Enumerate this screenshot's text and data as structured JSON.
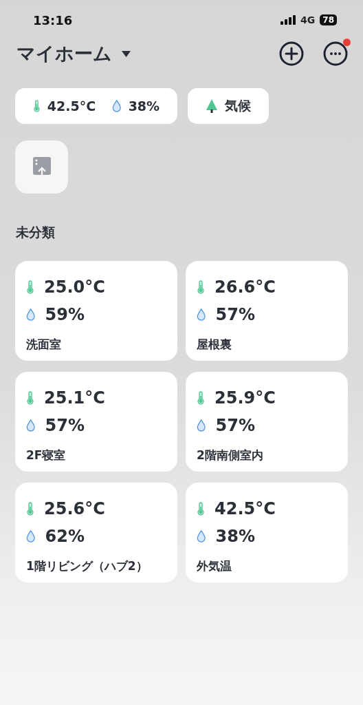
{
  "status_bar": {
    "time": "13:16",
    "network": "4G",
    "battery": "78"
  },
  "header": {
    "title": "マイホーム",
    "more_notification": true
  },
  "summary": {
    "temperature": "42.5°C",
    "humidity": "38%"
  },
  "climate_chip": {
    "label": "気候"
  },
  "section": {
    "title": "未分類"
  },
  "sensors": [
    {
      "temperature": "25.0°C",
      "humidity": "59%",
      "name": "洗面室"
    },
    {
      "temperature": "26.6°C",
      "humidity": "57%",
      "name": "屋根裏"
    },
    {
      "temperature": "25.1°C",
      "humidity": "57%",
      "name": "2F寝室"
    },
    {
      "temperature": "25.9°C",
      "humidity": "57%",
      "name": "2階南側室内"
    },
    {
      "temperature": "25.6°C",
      "humidity": "62%",
      "name": "1階リビング（ハブ2）"
    },
    {
      "temperature": "42.5°C",
      "humidity": "38%",
      "name": "外気温"
    }
  ]
}
